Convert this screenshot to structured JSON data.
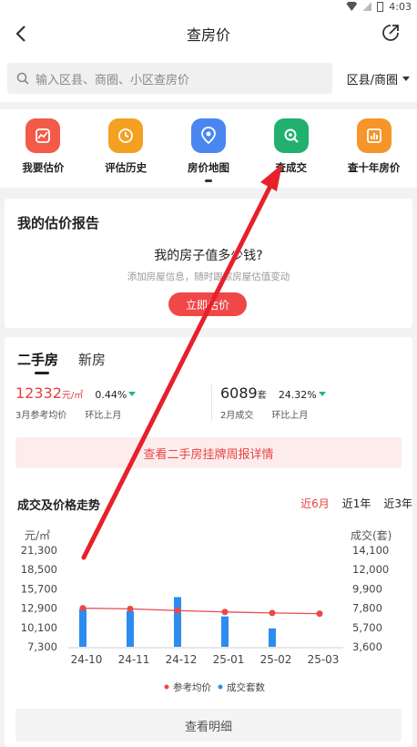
{
  "status": {
    "time": "4:03"
  },
  "header": {
    "title": "查房价"
  },
  "search": {
    "placeholder": "输入区县、商圈、小区查房价",
    "area_label": "区县/商圈"
  },
  "tools": [
    {
      "label": "我要估价",
      "color": "#f25a4a"
    },
    {
      "label": "评估历史",
      "color": "#f4a020"
    },
    {
      "label": "房价地图",
      "color": "#4a86f0"
    },
    {
      "label": "查成交",
      "color": "#22b070"
    },
    {
      "label": "查十年房价",
      "color": "#f5952a"
    }
  ],
  "report": {
    "title": "我的估价报告",
    "question": "我的房子值多少钱?",
    "subtitle": "添加房屋信息，随时跟踪房屋估值变动",
    "button": "立即估价"
  },
  "market": {
    "tabs": [
      "二手房",
      "新房"
    ],
    "price": {
      "value": "12332",
      "unit": "元/㎡",
      "change": "0.44%",
      "caption": "3月参考均价",
      "caption2": "环比上月"
    },
    "deals": {
      "value": "6089",
      "unit": "套",
      "change": "24.32%",
      "caption": "2月成交",
      "caption2": "环比上月"
    },
    "weekly_link": "查看二手房挂牌周报详情",
    "trend_title": "成交及价格走势",
    "periods": [
      "近6月",
      "近1年",
      "近3年"
    ],
    "detail_button": "查看明细"
  },
  "chart_data": {
    "type": "bar",
    "categories": [
      "24-10",
      "24-11",
      "24-12",
      "25-01",
      "25-02",
      "25-03"
    ],
    "left_axis_label": "元/㎡",
    "right_axis_label": "成交(套)",
    "left_ticks": [
      "21,300",
      "18,500",
      "15,700",
      "12,900",
      "10,100",
      "7,300"
    ],
    "right_ticks": [
      "14,100",
      "12,000",
      "9,900",
      "7,800",
      "5,700",
      "3,600"
    ],
    "ylim_left": [
      7300,
      21300
    ],
    "ylim_right": [
      3600,
      14100
    ],
    "series": [
      {
        "name": "参考均价",
        "type": "line",
        "axis": "left",
        "color": "#e84a4a",
        "values": [
          12900,
          12800,
          12550,
          12350,
          12200,
          12100
        ]
      },
      {
        "name": "成交套数",
        "type": "bar",
        "axis": "right",
        "color": "#2d8cf0",
        "values": [
          7700,
          7500,
          9000,
          6900,
          5600,
          null
        ]
      }
    ],
    "grid": false,
    "legend": "bottom"
  }
}
